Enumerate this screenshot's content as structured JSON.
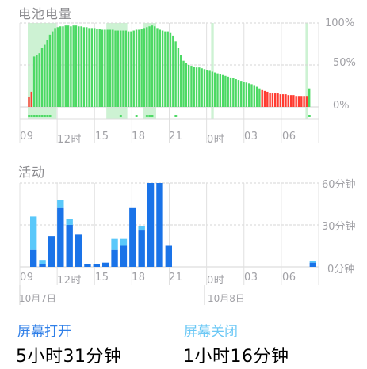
{
  "battery": {
    "title": "电池电量",
    "y_ticks": [
      "100%",
      "50%",
      "0%"
    ],
    "x_ticks": [
      "09",
      "12时",
      "15",
      "18",
      "21",
      "0时",
      "03",
      "06"
    ]
  },
  "activity": {
    "title": "活动",
    "y_ticks": [
      "60分钟",
      "30分钟",
      "0分钟"
    ],
    "x_ticks": [
      "09",
      "12时",
      "15",
      "18",
      "21",
      "0时",
      "03",
      "06"
    ],
    "dates": [
      "10月7日",
      "10月8日"
    ]
  },
  "summary": {
    "screen_on_label": "屏幕打开",
    "screen_on_value": "5小时31分钟",
    "screen_off_label": "屏幕关闭",
    "screen_off_value": "1小时16分钟"
  },
  "colors": {
    "battery_green": "#4cd964",
    "battery_red": "#ff3b30",
    "charging_band": "#cdf2d3",
    "screen_on": "#1a73e8",
    "screen_off": "#5ac8fa"
  },
  "chart_data": [
    {
      "type": "bar",
      "title": "电池电量",
      "ylim": [
        0,
        100
      ],
      "x_ticks": [
        "09",
        "12时",
        "15",
        "18",
        "21",
        "0时",
        "03",
        "06"
      ],
      "values": [
        12,
        18,
        60,
        62,
        64,
        70,
        74,
        80,
        86,
        90,
        94,
        95,
        96,
        96,
        97,
        97,
        96,
        97,
        97,
        96,
        96,
        95,
        95,
        94,
        94,
        94,
        93,
        93,
        92,
        92,
        92,
        92,
        92,
        91,
        91,
        91,
        91,
        91,
        90,
        90,
        91,
        92,
        92,
        93,
        94,
        95,
        96,
        97,
        96,
        94,
        92,
        91,
        90,
        90,
        88,
        85,
        78,
        70,
        62,
        55,
        52,
        50,
        49,
        48,
        47,
        47,
        46,
        45,
        44,
        43,
        42,
        41,
        40,
        39,
        38,
        37,
        36,
        35,
        34,
        33,
        32,
        31,
        30,
        29,
        28,
        27,
        26,
        24,
        22,
        20,
        19,
        18,
        17,
        16,
        16,
        16,
        15,
        15,
        15,
        14,
        14,
        14,
        13,
        13,
        13,
        13,
        13,
        22
      ],
      "charging_bands": [
        [
          0,
          11
        ],
        [
          30,
          38
        ],
        [
          44,
          49
        ],
        [
          70,
          71
        ],
        [
          106,
          107
        ]
      ],
      "status_marks": [
        1,
        1,
        1,
        1,
        1,
        1,
        1,
        1,
        1,
        0,
        0,
        0,
        0,
        0,
        0,
        0,
        0,
        0,
        0,
        0,
        0,
        0,
        0,
        0,
        0,
        0,
        0,
        0,
        0,
        0,
        0,
        0,
        0,
        0,
        0,
        1,
        0,
        0,
        0,
        0,
        0,
        1,
        0,
        0,
        0,
        1,
        1,
        1,
        0,
        0,
        0,
        0,
        0,
        0,
        0,
        0,
        1,
        0,
        0,
        0,
        0,
        0,
        0,
        0,
        0,
        0,
        0,
        0,
        0,
        0,
        0,
        0,
        0,
        0,
        0,
        0,
        0,
        0,
        0,
        0,
        0,
        0,
        0,
        0,
        0,
        0,
        0,
        0,
        0,
        0,
        0,
        0,
        0,
        0,
        0,
        0,
        0,
        0,
        0,
        0,
        0,
        0,
        0,
        0,
        0,
        0,
        0,
        1
      ]
    },
    {
      "type": "bar",
      "title": "活动",
      "ylim": [
        0,
        60
      ],
      "x_ticks": [
        "09",
        "12时",
        "15",
        "18",
        "21",
        "0时",
        "03",
        "06"
      ],
      "series": [
        {
          "name": "屏幕打开",
          "values": [
            12,
            2,
            22,
            42,
            30,
            23,
            2,
            2,
            3,
            12,
            15,
            42,
            26,
            60,
            60,
            15,
            0,
            0,
            0,
            0,
            0,
            0,
            0,
            0,
            0,
            0,
            0,
            0,
            0,
            0,
            0,
            3
          ]
        },
        {
          "name": "屏幕关闭",
          "values": [
            24,
            3,
            0,
            6,
            4,
            0,
            0,
            0,
            0,
            8,
            5,
            0,
            3,
            0,
            0,
            0,
            0,
            0,
            0,
            0,
            0,
            0,
            0,
            0,
            0,
            0,
            0,
            0,
            0,
            0,
            0,
            1
          ]
        }
      ]
    }
  ]
}
